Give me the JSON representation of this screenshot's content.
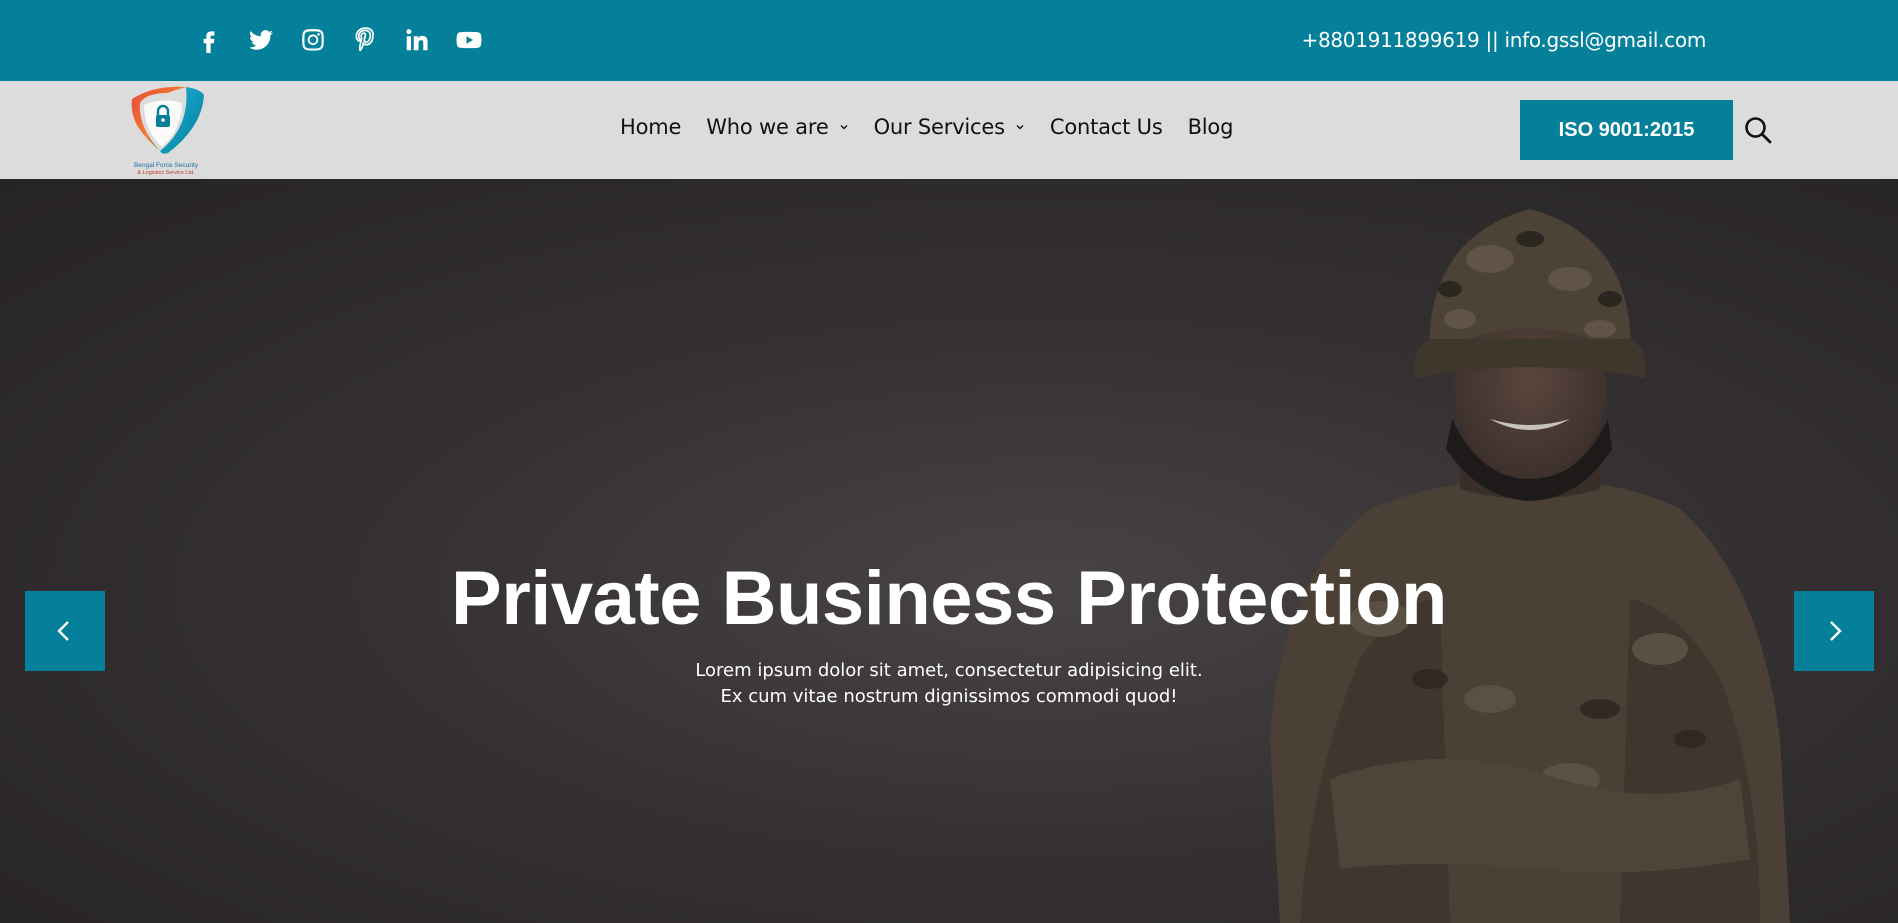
{
  "topbar": {
    "social_icons": [
      "facebook-icon",
      "twitter-icon",
      "instagram-icon",
      "pinterest-icon",
      "linkedin-icon",
      "youtube-icon"
    ],
    "contact": "+8801911899619 || info.gssl@gmail.com"
  },
  "nav": {
    "logo_text_line1": "Bengal Force Security",
    "logo_text_line2": "& Logistics Service Ltd.",
    "items": [
      {
        "label": "Home",
        "dropdown": false
      },
      {
        "label": "Who we are",
        "dropdown": true
      },
      {
        "label": "Our Services",
        "dropdown": true
      },
      {
        "label": "Contact Us",
        "dropdown": false
      },
      {
        "label": "Blog",
        "dropdown": false
      }
    ],
    "iso_button": "ISO 9001:2015"
  },
  "hero": {
    "title": "Private Business Protection",
    "subtitle_line1": "Lorem ipsum dolor sit amet, consectetur adipisicing elit.",
    "subtitle_line2": "Ex cum vitae nostrum dignissimos commodi quod!"
  },
  "colors": {
    "brand": "#05809a",
    "nav_bg": "#dcdcdc"
  }
}
